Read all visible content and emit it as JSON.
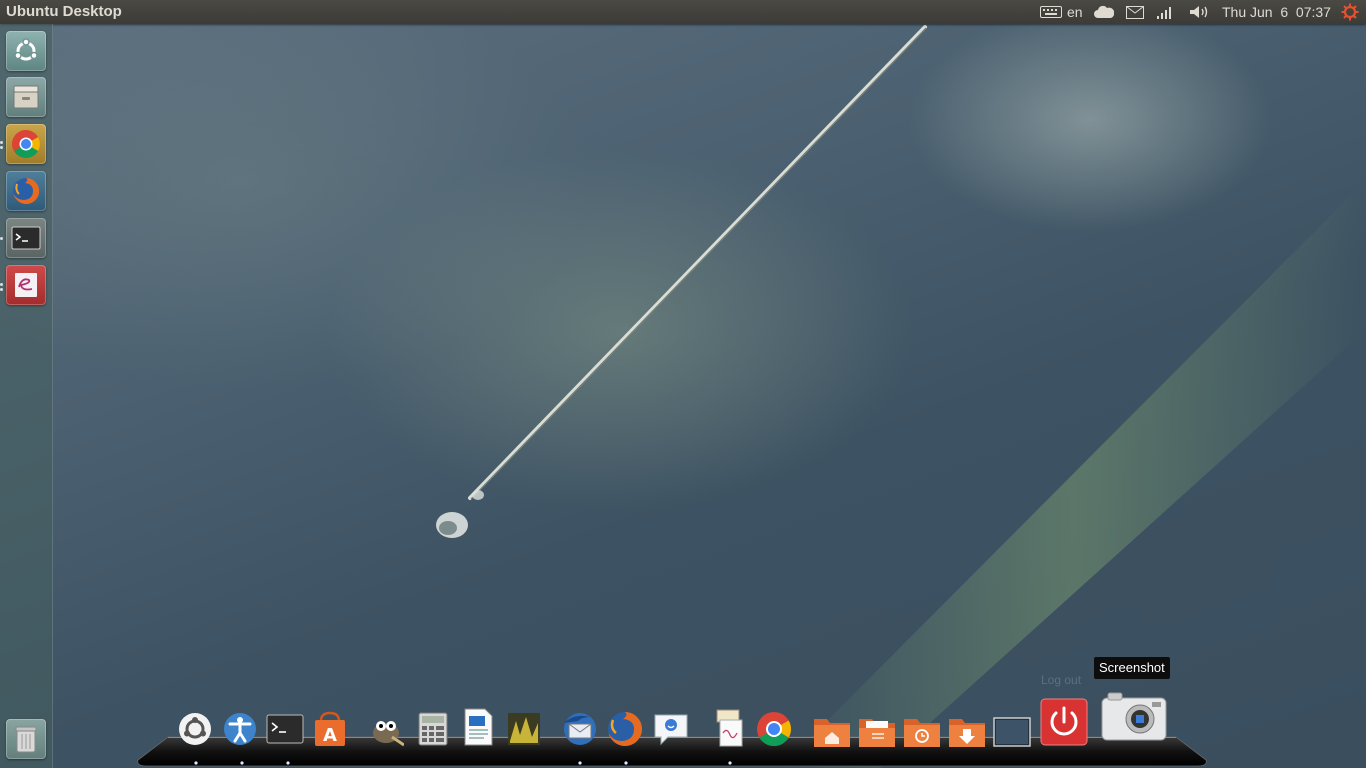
{
  "panel": {
    "title": "Ubuntu Desktop",
    "keyboard_layout": "en",
    "clock": "Thu Jun  6  07:37",
    "icons": [
      "keyboard-icon",
      "cloud-icon",
      "mail-icon",
      "network-signal-icon",
      "volume-icon",
      "session-gear-icon"
    ]
  },
  "launcher": {
    "items": [
      {
        "name": "dash-home",
        "icon": "ubuntu-logo-icon"
      },
      {
        "name": "files",
        "icon": "file-cabinet-icon"
      },
      {
        "name": "chrome",
        "icon": "chrome-icon"
      },
      {
        "name": "firefox",
        "icon": "firefox-icon"
      },
      {
        "name": "terminal",
        "icon": "terminal-icon"
      },
      {
        "name": "text-editor",
        "icon": "editor-icon"
      },
      {
        "name": "trash",
        "icon": "trash-icon"
      }
    ]
  },
  "dock": {
    "items": [
      {
        "name": "ubuntu",
        "icon": "ubuntu-logo-icon"
      },
      {
        "name": "accessibility",
        "icon": "accessibility-icon"
      },
      {
        "name": "terminal",
        "icon": "terminal-icon"
      },
      {
        "name": "software-center",
        "icon": "software-center-icon"
      },
      {
        "name": "gimp",
        "icon": "gimp-icon"
      },
      {
        "name": "calculator",
        "icon": "calculator-icon"
      },
      {
        "name": "writer",
        "icon": "document-icon"
      },
      {
        "name": "image-viewer",
        "icon": "image-icon"
      },
      {
        "name": "thunderbird",
        "icon": "thunderbird-icon"
      },
      {
        "name": "firefox",
        "icon": "firefox-icon"
      },
      {
        "name": "messaging",
        "icon": "chat-icon"
      },
      {
        "name": "reader",
        "icon": "books-icon"
      },
      {
        "name": "chrome",
        "icon": "chrome-icon"
      },
      {
        "name": "home-folder",
        "icon": "home-folder-icon"
      },
      {
        "name": "documents-folder",
        "icon": "documents-folder-icon"
      },
      {
        "name": "backup-folder",
        "icon": "history-folder-icon"
      },
      {
        "name": "downloads-folder",
        "icon": "downloads-folder-icon"
      },
      {
        "name": "show-desktop",
        "icon": "desktop-icon"
      },
      {
        "name": "log-out",
        "icon": "power-icon"
      },
      {
        "name": "screenshot",
        "icon": "camera-icon"
      }
    ],
    "tooltip": "Screenshot",
    "ghost_label": "Log out"
  },
  "colors": {
    "panel_bg": "#3c3b37",
    "power_red": "#d33",
    "folder_orange": "#e8732c"
  }
}
